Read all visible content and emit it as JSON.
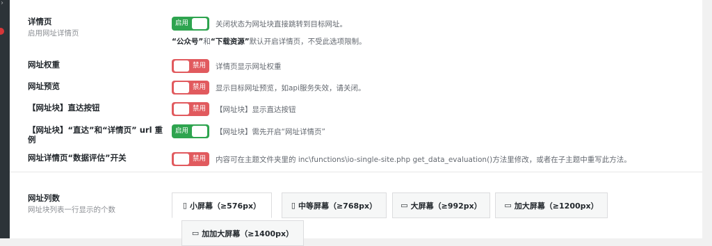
{
  "sidebar": {
    "collapse_glyph": "›",
    "notification_color": "#d63638"
  },
  "fields": [
    {
      "label": "详情页",
      "subtitle": "启用网址详情页",
      "toggle": "启用",
      "state": "on",
      "desc": "关闭状态为网址块直接跳转到目标网址。"
    },
    {
      "label": "网址权重",
      "toggle": "禁用",
      "state": "off",
      "desc": "详情页显示网址权重"
    },
    {
      "label": "网址预览",
      "toggle": "禁用",
      "state": "off",
      "desc": "显示目标网址预览，如api服务失效，请关闭。"
    },
    {
      "label": "【网址块】直达按钮",
      "toggle": "禁用",
      "state": "off",
      "desc": "【网址块】显示直达按钮"
    },
    {
      "label_line1": "【网址块】“直达”和“详情页” url 重",
      "label_line2": "例",
      "toggle": "启用",
      "state": "on",
      "desc": "【网址块】需先开启“网址详情页”"
    },
    {
      "label": "网址详情页“数据评估”开关",
      "toggle": "禁用",
      "state": "off",
      "desc": "内容可在主题文件夹里的 inc\\functions\\io-single-site.php get_data_evaluation()方法里修改，或者在子主题中重写此方法。"
    }
  ],
  "note": {
    "quote1": "“公众号”",
    "and": "和",
    "quote2": "“下载资源”",
    "rest": "默认开启详情页，不受此选项限制。"
  },
  "columns": {
    "label": "网址列数",
    "subtitle": "网址块列表一行显示的个数",
    "tabs": [
      {
        "icon": "mobile-icon",
        "glyph": "▯",
        "label": "小屏幕（≥576px）"
      },
      {
        "icon": "tablet-icon",
        "glyph": "▯",
        "label": "中等屏幕（≥768px）"
      },
      {
        "icon": "desktop-icon",
        "glyph": "▭",
        "label": "大屏幕（≥992px）"
      },
      {
        "icon": "desktop-icon",
        "glyph": "▭",
        "label": "加大屏幕（≥1200px）"
      },
      {
        "icon": "desktop-icon",
        "glyph": "▭",
        "label": "加加大屏幕（≥1400px）"
      }
    ]
  },
  "colors": {
    "on": "#2ea44f",
    "off": "#e15a5e"
  }
}
